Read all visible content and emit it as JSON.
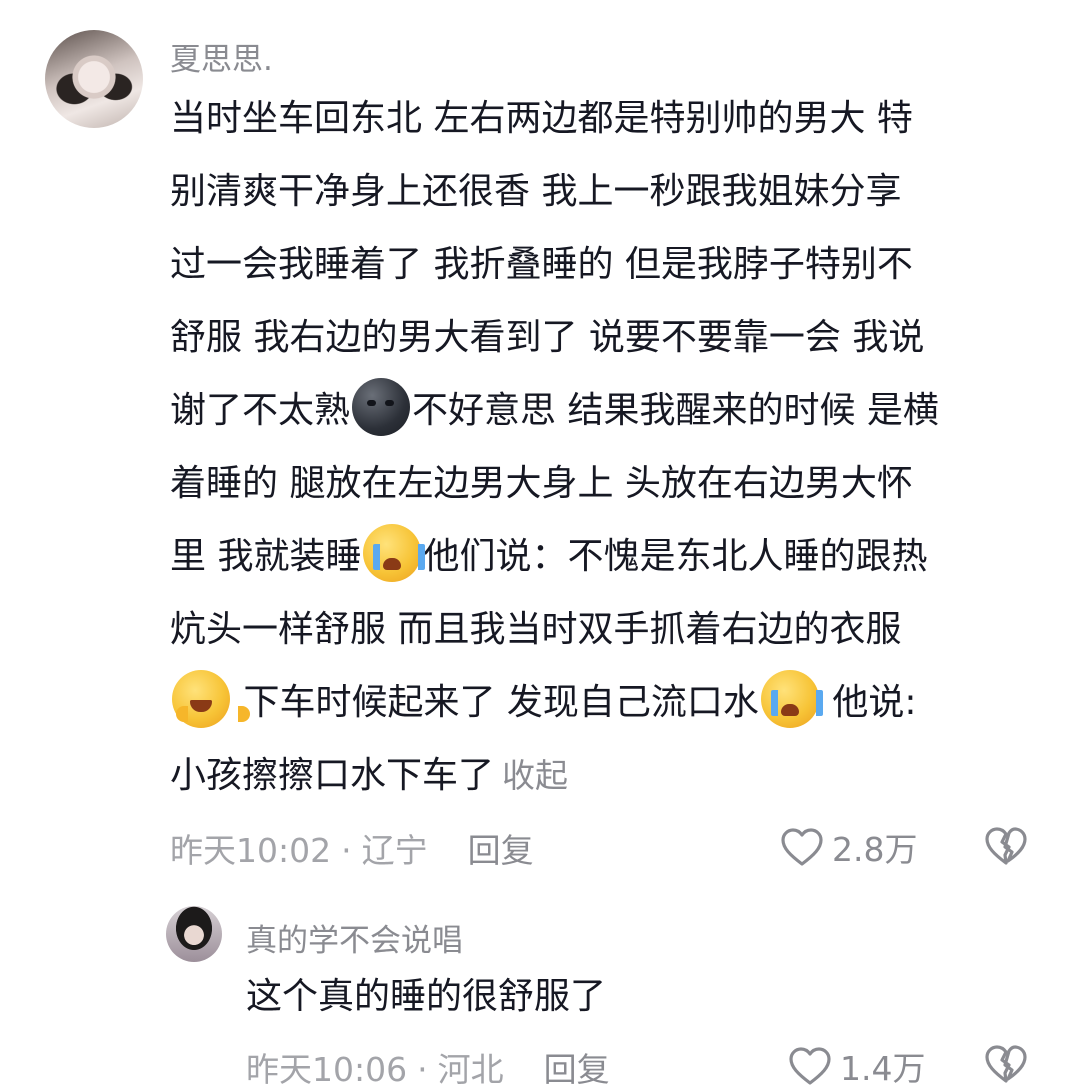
{
  "main_comment": {
    "username": "夏思思.",
    "lines": [
      "当时坐车回东北 左右两边都是特别帅的男大 特",
      "别清爽干净身上还很香 我上一秒跟我姐妹分享",
      "过一会我睡着了 我折叠睡的 但是我脖子特别不",
      "舒服 我右边的男大看到了 说要不要靠一会 我说",
      "谢了不太熟",
      "不好意思 结果我醒来的时候 是横",
      "着睡的 腿放在左边男大身上 头放在右边男大怀",
      "里 我就装睡",
      "他们说：不愧是东北人睡的跟热",
      "炕头一样舒服  而且我当时双手抓着右边的衣服",
      " 下车时候起来了 发现自己流口水",
      " 他说:",
      "小孩擦擦口水下车了"
    ],
    "collapse_label": "收起",
    "time": "昨天10:02",
    "separator": "·",
    "location": "辽宁",
    "reply_label": "回复",
    "likes": "2.8万"
  },
  "reply_comment": {
    "username": "真的学不会说唱",
    "text": "这个真的睡的很舒服了",
    "time": "昨天10:06",
    "separator": "·",
    "location": "河北",
    "reply_label": "回复",
    "likes": "1.4万"
  },
  "icons": {
    "like": "heart-outline-icon",
    "dislike": "broken-heart-icon",
    "emoji_1": "new-moon-face-emoji",
    "emoji_2": "loudly-crying-face-emoji",
    "emoji_3": "hugging-face-emoji"
  },
  "colors": {
    "text": "#161823",
    "secondary": "#8a8b91",
    "meta": "#a3a4a9"
  }
}
